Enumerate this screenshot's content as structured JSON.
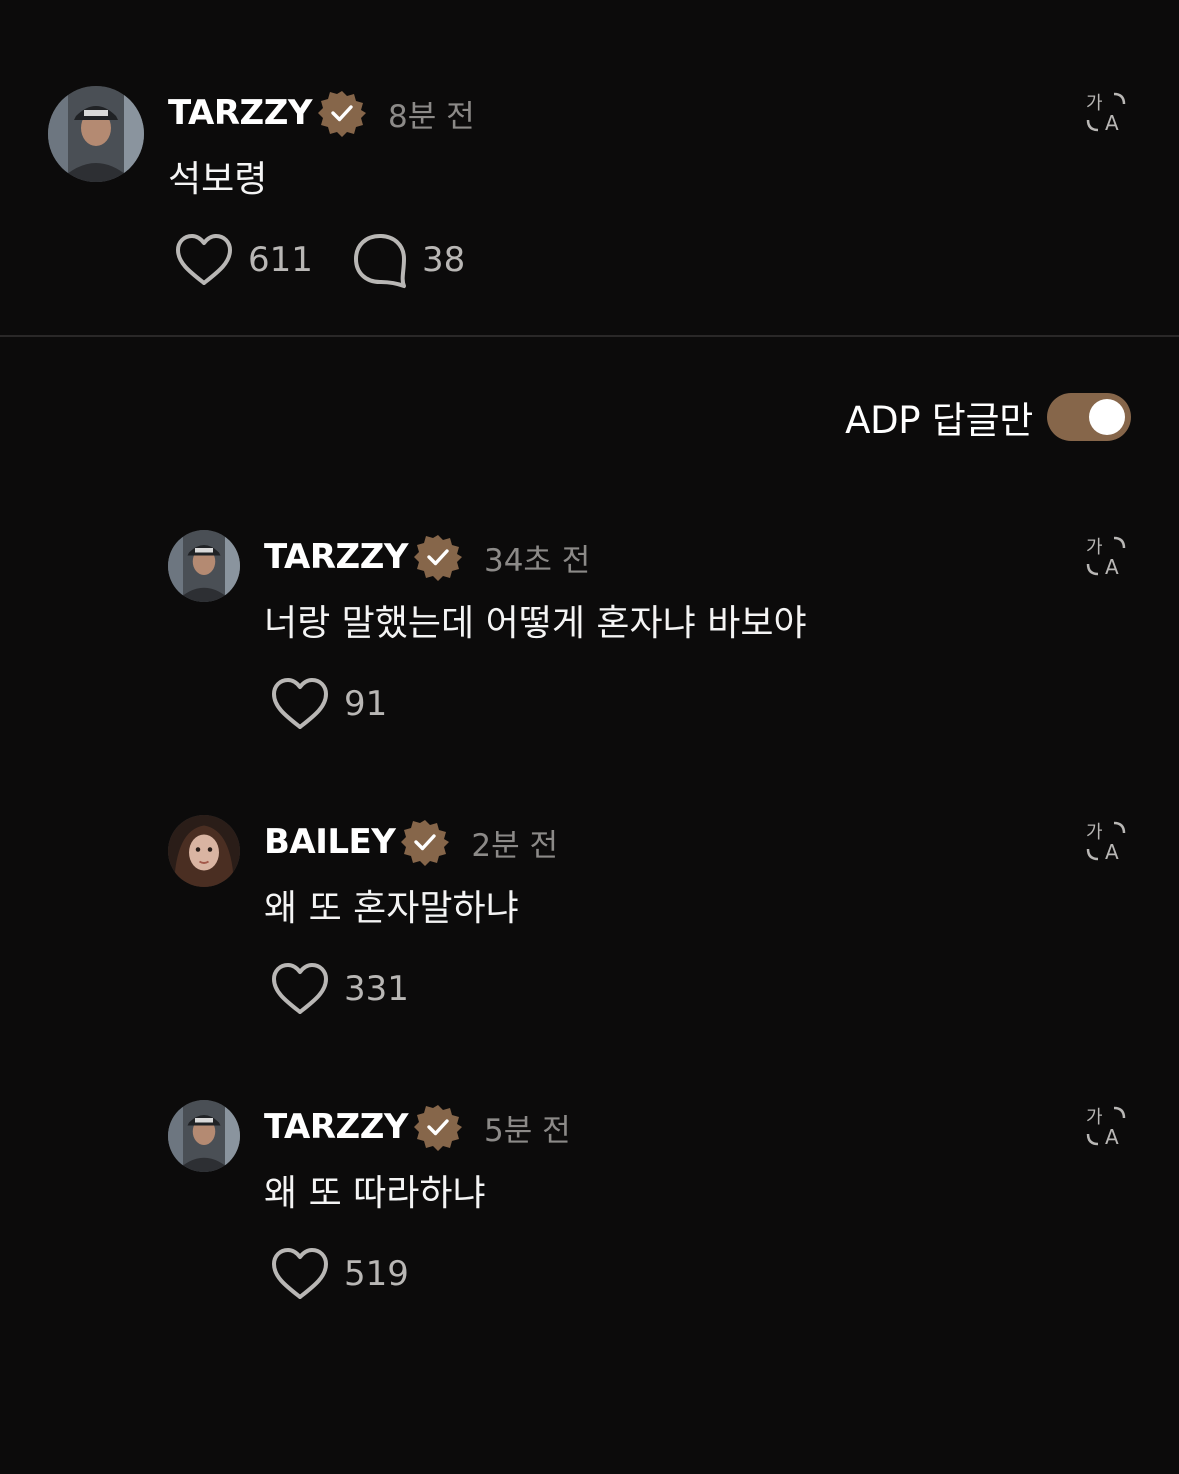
{
  "colors": {
    "background": "#0c0b0b",
    "verified_badge": "#86664a",
    "toggle_on": "#86664a",
    "muted_text": "#8c8a88"
  },
  "post": {
    "username": "TARZZY",
    "time": "8분 전",
    "text": "석보령",
    "likes": "611",
    "comments": "38"
  },
  "filter": {
    "label": "ADP 답글만",
    "enabled": true
  },
  "replies": [
    {
      "username": "TARZZY",
      "time": "34초 전",
      "text": "너랑 말했는데 어떻게 혼자냐 바보야",
      "likes": "91"
    },
    {
      "username": "BAILEY",
      "time": "2분 전",
      "text": "왜 또 혼자말하냐",
      "likes": "331"
    },
    {
      "username": "TARZZY",
      "time": "5분 전",
      "text": "왜 또 따라하냐",
      "likes": "519"
    }
  ],
  "icons": {
    "verified": "verified-badge-icon",
    "like": "heart-icon",
    "comment": "speech-bubble-icon",
    "translate": "translate-icon"
  }
}
